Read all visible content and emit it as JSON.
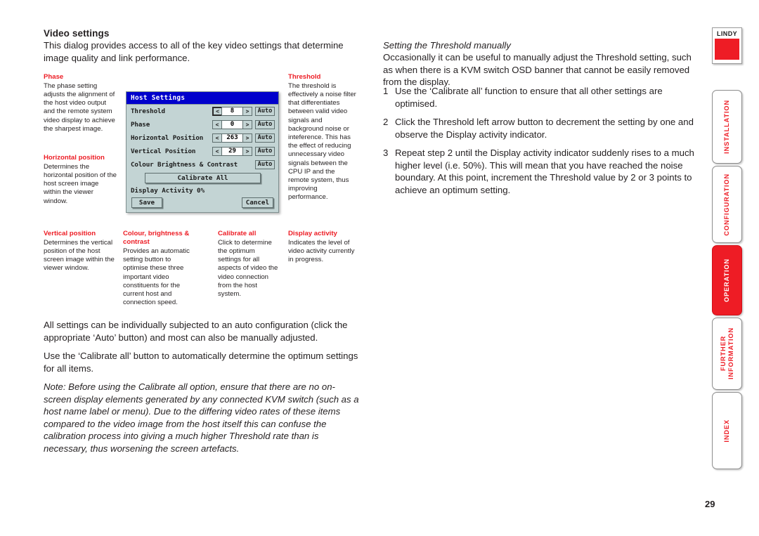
{
  "page": {
    "title": "Video settings",
    "intro": "This dialog provides access to all of the key video settings that determine image quality and link performance.",
    "number": "29"
  },
  "annotations": [
    {
      "key": "phase",
      "title": "Phase",
      "body": "The phase setting adjusts the alignment of the host video output and the remote system video display to achieve the sharpest image."
    },
    {
      "key": "horizontal-position",
      "title": "Horizontal position",
      "body": "Determines the horizontal position of the host screen image within the viewer window."
    },
    {
      "key": "threshold",
      "title": "Threshold",
      "body": "The threshold is effectively a noise filter that differentiates between valid video signals and background noise or inteference. This has the effect of reducing unnecessary video signals between the CPU IP and the remote system, thus improving performance."
    },
    {
      "key": "vertical-position",
      "title": "Vertical position",
      "body": "Determines the vertical position of the host screen image within the viewer window."
    },
    {
      "key": "colour-brightness-contrast",
      "title": "Colour, brightness & contrast",
      "body": "Provides an automatic setting button to optimise these three important video constituents for the current host and connection speed."
    },
    {
      "key": "calibrate-all",
      "title": "Calibrate all",
      "body": "Click to determine the optimum settings for all aspects of video the video connection from the host system."
    },
    {
      "key": "display-activity",
      "title": "Display activity",
      "body": "Indicates the level of video activity currently in progress."
    }
  ],
  "dialog": {
    "title": "Host Settings",
    "rows": [
      {
        "label": "Threshold",
        "value": "8",
        "dec": "<",
        "inc": ">",
        "auto": "Auto",
        "focused": true
      },
      {
        "label": "Phase",
        "value": "0",
        "dec": "<",
        "inc": ">",
        "auto": "Auto",
        "focused": false
      },
      {
        "label": "Horizontal Position",
        "value": "263",
        "dec": "<",
        "inc": ">",
        "auto": "Auto",
        "focused": false
      },
      {
        "label": "Vertical Position",
        "value": "29",
        "dec": "<",
        "inc": ">",
        "auto": "Auto",
        "focused": false
      }
    ],
    "colour_row": {
      "label": "Colour Brightness & Contrast",
      "auto": "Auto"
    },
    "calibrate_label": "Calibrate All",
    "activity_label": "Display Activity 0%",
    "save_label": "Save",
    "cancel_label": "Cancel",
    "colors": {
      "titlebar": "#0000cc",
      "body": "#c3d4d4"
    }
  },
  "right_column": {
    "heading": "Setting the Threshold manually",
    "paragraph": "Occasionally it can be useful to manually adjust the Threshold setting, such as when there is a KVM switch OSD banner that cannot be easily removed from the display.",
    "steps": [
      {
        "num": "1",
        "text": "Use the ‘Calibrate all’ function to ensure that all other settings are optimised."
      },
      {
        "num": "2",
        "text": "Click the Threshold left arrow button to decrement the setting by one and observe the Display activity indicator."
      },
      {
        "num": "3",
        "text": "Repeat step 2 until the Display activity indicator suddenly rises to a much higher level (i.e. 50%). This will mean that you have reached the noise boundary. At this point, increment the Threshold value by 2 or 3 points to achieve an optimum setting."
      }
    ]
  },
  "lower_paragraphs": [
    "All settings can be individually subjected to an auto configuration (click the appropriate ‘Auto’ button) and most can also be manually adjusted.",
    "Use the ‘Calibrate all’ button to automatically determine the optimum settings for all items.",
    "Note: Before using the Calibrate all option, ensure that there are no on-screen display elements generated by any connected KVM switch (such as a host name label or menu). Due to the differing video rates of these items compared to the video image from the host itself this can confuse the calibration process into giving a much higher Threshold rate than is necessary, thus worsening the screen artefacts."
  ],
  "sidebar": {
    "logo_text": "LINDY",
    "logo_color": "#ee1c25",
    "tabs": [
      {
        "key": "installation",
        "label": "INSTALLATION",
        "active": false
      },
      {
        "key": "configuration",
        "label": "CONFIGURATION",
        "active": false
      },
      {
        "key": "operation",
        "label": "OPERATION",
        "active": true
      },
      {
        "key": "further-information",
        "label": "FURTHER\nINFORMATION",
        "active": false
      },
      {
        "key": "index",
        "label": "INDEX",
        "active": false
      }
    ]
  }
}
